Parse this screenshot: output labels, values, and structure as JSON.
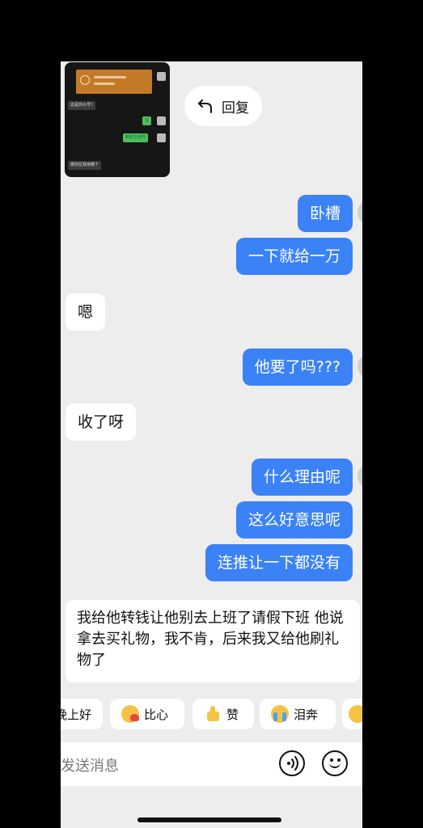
{
  "reply_button": {
    "label": "回复"
  },
  "thumbnail": {
    "lines": [
      "这是你大号?",
      "在",
      "新护卫挂号",
      "那你拉我用哪个"
    ]
  },
  "messages": [
    {
      "side": "me",
      "text": "卧槽"
    },
    {
      "side": "me",
      "text": "一下就给一万"
    },
    {
      "side": "other",
      "text": "嗯"
    },
    {
      "side": "me",
      "text": "他要了吗???"
    },
    {
      "side": "other",
      "text": "收了呀"
    },
    {
      "side": "me",
      "text": "什么理由呢"
    },
    {
      "side": "me",
      "text": "这么好意思呢"
    },
    {
      "side": "me",
      "text": "连推让一下都没有"
    },
    {
      "side": "other",
      "text": "我给他转钱让他别去上班了请假下班 他说拿去买礼物，我不肯，后来我又给他刷礼物了"
    }
  ],
  "quick_replies": [
    {
      "label": "晚上好",
      "icon": "moon-icon"
    },
    {
      "label": "比心",
      "icon": "heart-hands-icon"
    },
    {
      "label": "赞",
      "icon": "thumbs-up-icon"
    },
    {
      "label": "泪奔",
      "icon": "crying-face-icon"
    }
  ],
  "input": {
    "placeholder": "发送消息"
  }
}
